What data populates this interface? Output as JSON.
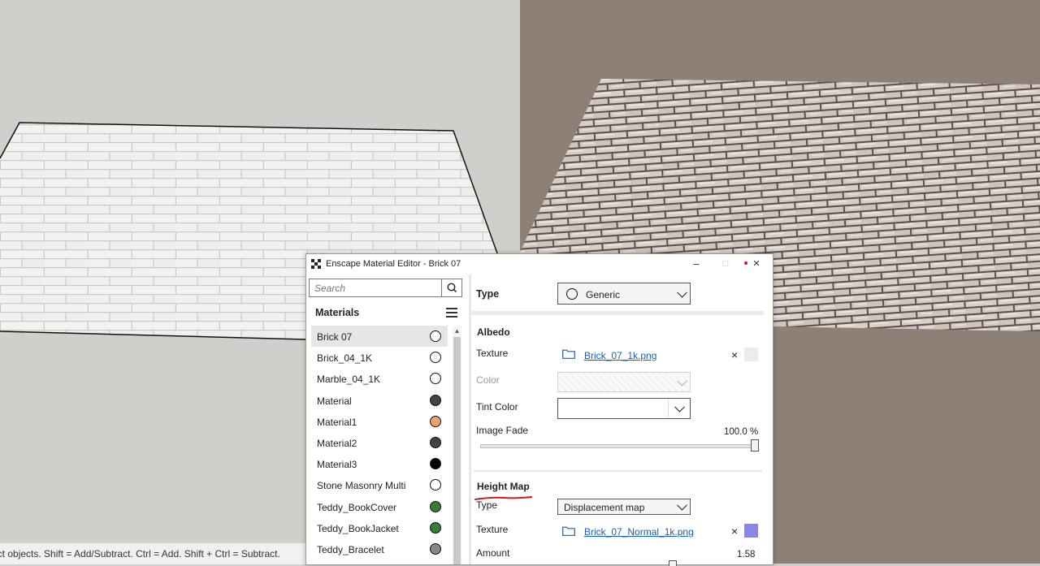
{
  "status_bar": {
    "text": "ect objects. Shift = Add/Subtract. Ctrl = Add. Shift + Ctrl = Subtract."
  },
  "editor": {
    "title": "Enscape Material Editor - Brick 07",
    "search": {
      "placeholder": "Search"
    },
    "materials_header": "Materials",
    "materials": [
      {
        "name": "Brick 07",
        "swatch": "#ffffff",
        "selected": true
      },
      {
        "name": "Brick_04_1K",
        "swatch": "#ffffff",
        "selected": false
      },
      {
        "name": "Marble_04_1K",
        "swatch": "#ffffff",
        "selected": false
      },
      {
        "name": "Material",
        "swatch": "#444444",
        "selected": false
      },
      {
        "name": "Material1",
        "swatch": "#f0a070",
        "selected": false
      },
      {
        "name": "Material2",
        "swatch": "#444444",
        "selected": false
      },
      {
        "name": "Material3",
        "swatch": "#000000",
        "selected": false
      },
      {
        "name": "Stone Masonry Multi",
        "swatch": "#ffffff",
        "selected": false
      },
      {
        "name": "Teddy_BookCover",
        "swatch": "#3a7a3a",
        "selected": false
      },
      {
        "name": "Teddy_BookJacket",
        "swatch": "#3a7a3a",
        "selected": false
      },
      {
        "name": "Teddy_Bracelet",
        "swatch": "#888888",
        "selected": false
      }
    ],
    "type_label": "Type",
    "type_value": "Generic",
    "albedo": {
      "title": "Albedo",
      "texture_label": "Texture",
      "texture_file": "Brick_07_1k.png",
      "color_label": "Color",
      "tint_label": "Tint Color",
      "fade_label": "Image Fade",
      "fade_value": "100.0 %",
      "fade_fraction": 1.0
    },
    "height_map": {
      "title": "Height Map",
      "type_label": "Type",
      "type_value": "Displacement map",
      "texture_label": "Texture",
      "texture_file": "Brick_07_Normal_1k.png",
      "amount_label": "Amount",
      "amount_value": "1.58"
    },
    "colors": {
      "link": "#1a5fb4",
      "normal_preview": "#8a86e6",
      "annotation": "#d01818"
    }
  }
}
